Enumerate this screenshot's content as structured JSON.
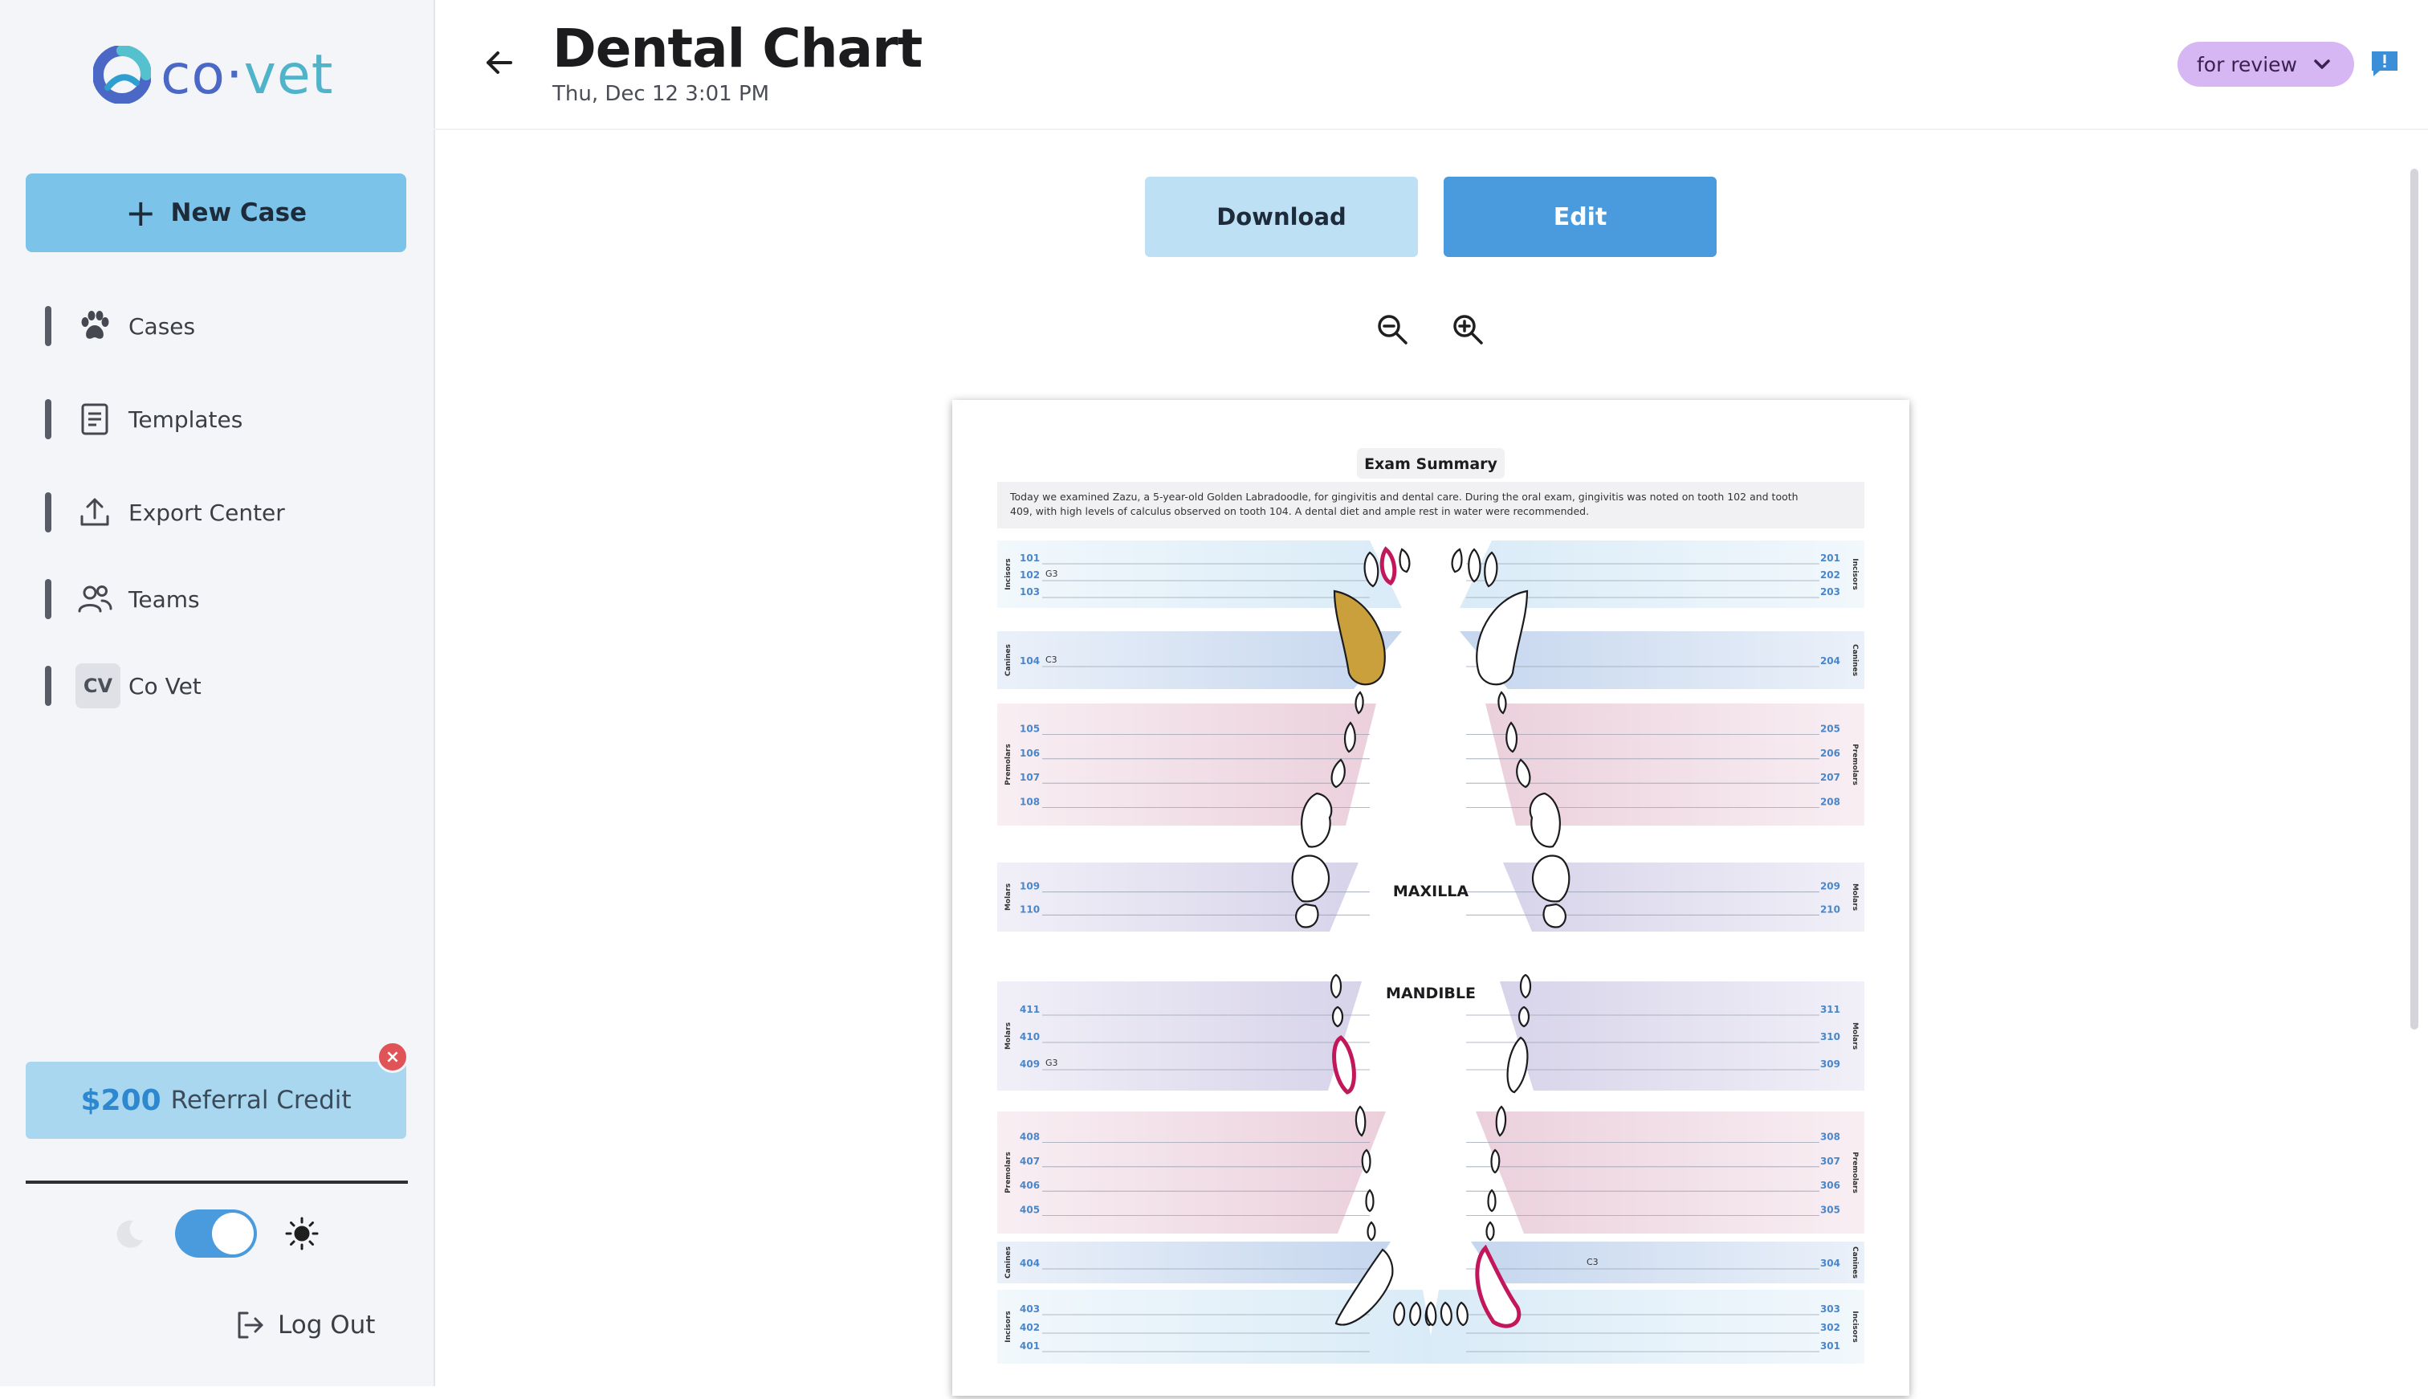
{
  "app": {
    "logo_text_left": "co",
    "logo_dot": "·",
    "logo_text_right": "vet",
    "brand_color": "#4a9ade"
  },
  "sidebar": {
    "new_case_label": "New Case",
    "items": [
      {
        "label": "Cases",
        "icon": "paw-icon"
      },
      {
        "label": "Templates",
        "icon": "document-icon"
      },
      {
        "label": "Export Center",
        "icon": "upload-icon"
      },
      {
        "label": "Teams",
        "icon": "users-icon"
      },
      {
        "label": "Co Vet",
        "initials": "CV"
      }
    ],
    "referral": {
      "amount": "$200",
      "label": "Referral Credit"
    },
    "theme": {
      "mode": "light"
    },
    "logout_label": "Log Out"
  },
  "header": {
    "title": "Dental Chart",
    "subtitle": "Thu, Dec 12 3:01 PM",
    "status": "for review"
  },
  "actions": {
    "download_label": "Download",
    "edit_label": "Edit"
  },
  "document": {
    "summary_title": "Exam Summary",
    "summary_line1": "Today we examined Zazu, a 5-year-old Golden Labradoodle, for gingivitis and dental care. During the oral exam, gingivitis was noted on tooth 102 and tooth",
    "summary_line2": "409, with high levels of calculus observed on tooth 104. A dental diet and ample rest in water were recommended.",
    "maxilla_label": "MAXILLA",
    "mandible_label": "MANDIBLE",
    "group_names": {
      "incisors": "Incisors",
      "canines": "Canines",
      "premolars": "Premolars",
      "molars": "Molars"
    },
    "upper_left": {
      "incisors": [
        "101",
        "102",
        "103"
      ],
      "canines": [
        "104"
      ],
      "premolars": [
        "105",
        "106",
        "107",
        "108"
      ],
      "molars": [
        "109",
        "110"
      ]
    },
    "upper_right": {
      "incisors": [
        "201",
        "202",
        "203"
      ],
      "canines": [
        "204"
      ],
      "premolars": [
        "205",
        "206",
        "207",
        "208"
      ],
      "molars": [
        "209",
        "210"
      ]
    },
    "lower_left": {
      "molars": [
        "411",
        "410",
        "409"
      ],
      "premolars": [
        "408",
        "407",
        "406",
        "405"
      ],
      "canines": [
        "404"
      ],
      "incisors": [
        "403",
        "402",
        "401"
      ]
    },
    "lower_right": {
      "molars": [
        "311",
        "310",
        "309"
      ],
      "premolars": [
        "308",
        "307",
        "306",
        "305"
      ],
      "canines": [
        "304"
      ],
      "incisors": [
        "303",
        "302",
        "301"
      ]
    },
    "annotations": {
      "t102": "G3",
      "t104": "C3",
      "t409": "G3",
      "t304": "C3"
    },
    "colors": {
      "incisors": "#d9ebf7",
      "canines": "#c5d6ee",
      "premolars": "#ebd0dc",
      "molars": "#d7d3ea",
      "gingivitis": "#c2185b",
      "calculus": "#c9a03c",
      "tooth_number": "#4a86c8"
    }
  }
}
